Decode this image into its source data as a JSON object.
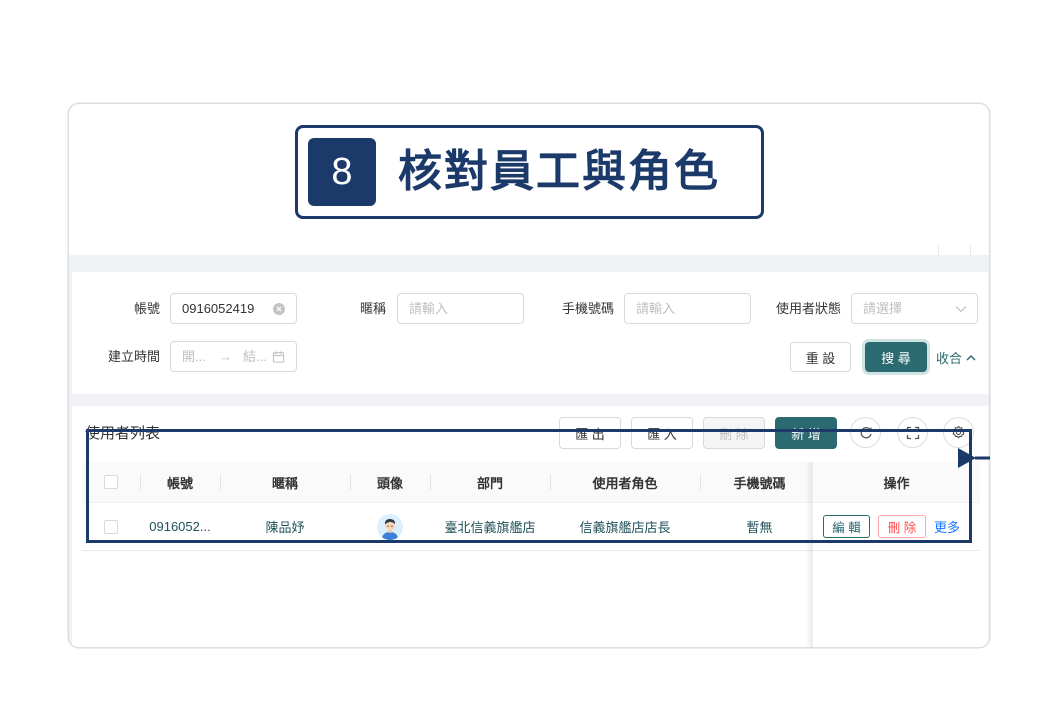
{
  "guide": {
    "step_number": "8",
    "title": "核對員工與角色"
  },
  "filters": {
    "account": {
      "label": "帳號",
      "value": "0916052419"
    },
    "nickname": {
      "label": "暱稱",
      "placeholder": "請輸入"
    },
    "phone": {
      "label": "手機號碼",
      "placeholder": "請輸入"
    },
    "status": {
      "label": "使用者狀態",
      "placeholder": "請選擇"
    },
    "created_time": {
      "label": "建立時間",
      "start_placeholder": "開...",
      "separator": "→",
      "end_placeholder": "結..."
    },
    "reset_label": "重 設",
    "search_label": "搜 尋",
    "collapse_label": "收合"
  },
  "user_table": {
    "title": "使用者列表",
    "toolbar": {
      "export_label": "匯 出",
      "import_label": "匯 入",
      "delete_label": "刪 除",
      "add_label": "新 增"
    },
    "columns": {
      "account": "帳號",
      "nickname": "暱稱",
      "avatar": "頭像",
      "department": "部門",
      "role": "使用者角色",
      "phone": "手機號碼",
      "actions": "操作"
    },
    "rows": [
      {
        "account": "0916052...",
        "nickname": "陳品妤",
        "department": "臺北信義旗艦店",
        "role": "信義旗艦店店長",
        "phone": "暫無",
        "edit_label": "編 輯",
        "delete_label": "刪 除",
        "more_label": "更多"
      }
    ]
  },
  "icons": {
    "account_clear": "close-circle-icon",
    "status_dropdown": "chevron-down-icon",
    "date_picker": "calendar-icon",
    "collapse": "chevron-up-icon",
    "reload": "reload-icon",
    "fullscreen": "fullscreen-icon",
    "column_settings": "gear-icon",
    "row_avatar": "user-avatar-icon",
    "highlight_pointer": "arrow-icon"
  },
  "colors": {
    "guide_navy": "#1b3a69",
    "primary": "#2b6a70",
    "danger": "#ff4d4f",
    "link": "#1677ff",
    "page_gray": "#f0f2f5"
  }
}
